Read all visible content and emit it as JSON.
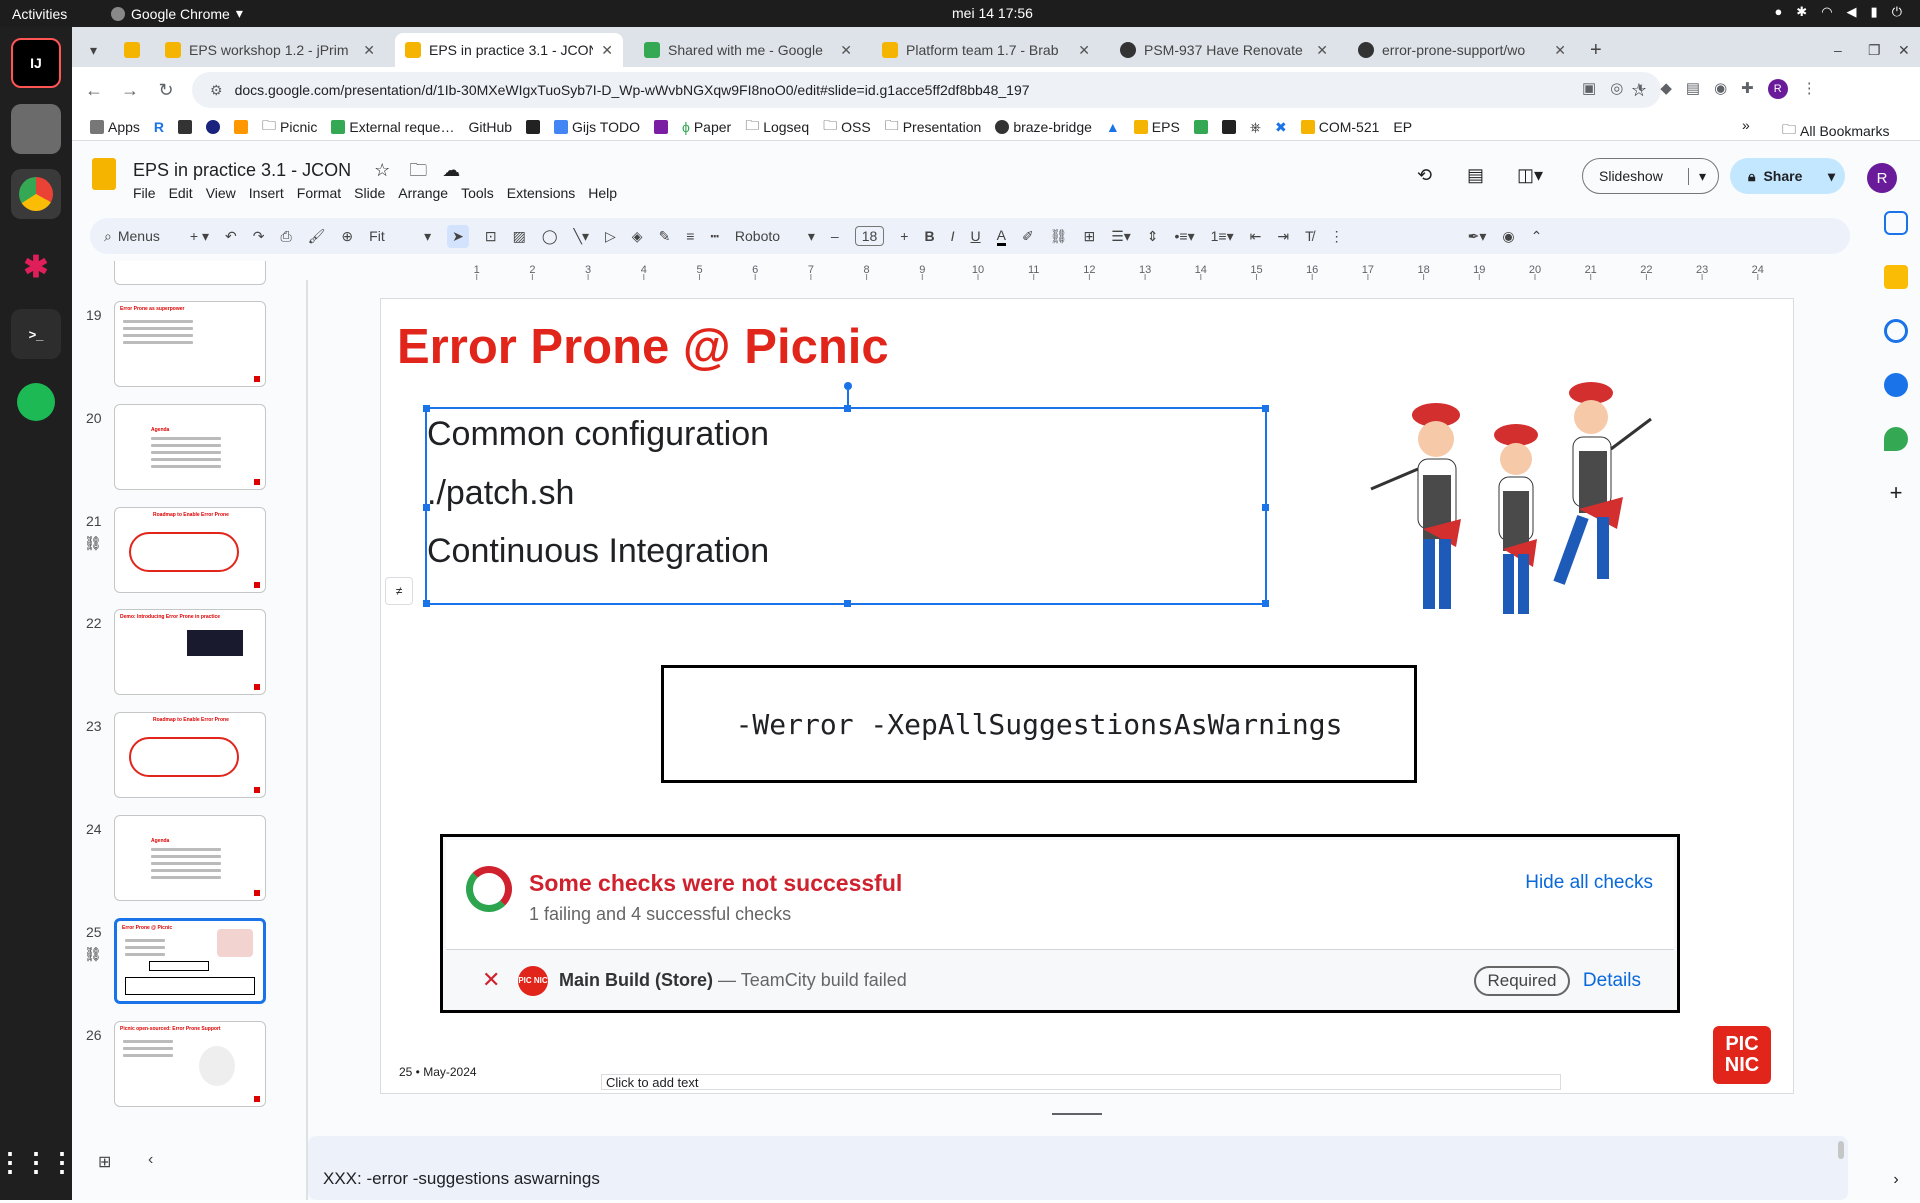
{
  "system": {
    "activities": "Activities",
    "app_name": "Google Chrome",
    "clock": "mei 14  17:56"
  },
  "tabs": [
    {
      "label": "EPS workshop 1.2 - jPrim",
      "active": false
    },
    {
      "label": "EPS in practice 3.1 - JCON",
      "active": true
    },
    {
      "label": "Shared with me - Google",
      "active": false
    },
    {
      "label": "Platform team 1.7 - Brab",
      "active": false
    },
    {
      "label": "PSM-937 Have Renovate",
      "active": false
    },
    {
      "label": "error-prone-support/wo",
      "active": false
    }
  ],
  "address": {
    "url": "docs.google.com/presentation/d/1Ib-30MXeWIgxTuoSyb7I-D_Wp-wWvbNGXqw9FI8noO0/edit#slide=id.g1acce5ff2df8bb48_197"
  },
  "bookmarks": [
    "Apps",
    "R",
    "",
    "",
    "",
    "Picnic",
    "External reque…",
    "GitHub",
    "",
    "Gijs TODO",
    "",
    "Paper",
    "Logseq",
    "OSS",
    "Presentation",
    "braze-bridge",
    "",
    "EPS",
    "",
    "",
    "",
    "",
    "COM-521",
    "EP"
  ],
  "bookmarks_all": "All Bookmarks",
  "docs": {
    "title": "EPS in practice 3.1 - JCON",
    "menu": [
      "File",
      "Edit",
      "View",
      "Insert",
      "Format",
      "Slide",
      "Arrange",
      "Tools",
      "Extensions",
      "Help"
    ],
    "slideshow": "Slideshow",
    "share": "Share",
    "avatar": "R"
  },
  "toolbar": {
    "search": "Menus",
    "zoom": "Fit",
    "font": "Roboto",
    "font_size": "18"
  },
  "ruler_ticks": [
    "1",
    "2",
    "3",
    "4",
    "5",
    "6",
    "7",
    "8",
    "9",
    "10",
    "11",
    "12",
    "13",
    "14",
    "15",
    "16",
    "17",
    "18",
    "19",
    "20",
    "21",
    "22",
    "23",
    "24"
  ],
  "filmstrip": [
    {
      "num": "19",
      "title": "Error Prone as superpower"
    },
    {
      "num": "20",
      "title": "Agenda"
    },
    {
      "num": "21",
      "title": "Roadmap to Enable Error Prone"
    },
    {
      "num": "22",
      "title": "Demo: Introducing Error Prone in practice"
    },
    {
      "num": "23",
      "title": "Roadmap to Enable Error Prone"
    },
    {
      "num": "24",
      "title": "Agenda"
    },
    {
      "num": "25",
      "title": "Error Prone @ Picnic"
    },
    {
      "num": "26",
      "title": "Picnic open-sourced: Error Prone Support"
    }
  ],
  "slide": {
    "title": "Error Prone @ Picnic",
    "items": [
      "Common configuration",
      "./patch.sh",
      "Continuous Integration"
    ],
    "code": "-Werror -XepAllSuggestionsAsWarnings",
    "checks": {
      "heading": "Some checks were not successful",
      "summary": "1 failing and 4 successful checks",
      "hide": "Hide all checks",
      "build_name": "Main Build (Store)",
      "build_status": "— TeamCity build failed",
      "required": "Required",
      "details": "Details",
      "logo": "PIC NIC"
    },
    "footer": "25 • May-2024",
    "placeholder": "Click to add text",
    "logo": "PIC NIC"
  },
  "notes": "XXX: -error -suggestions aswarnings",
  "colors": {
    "brand_red": "#e1251b",
    "accent_blue": "#1a73e8"
  }
}
